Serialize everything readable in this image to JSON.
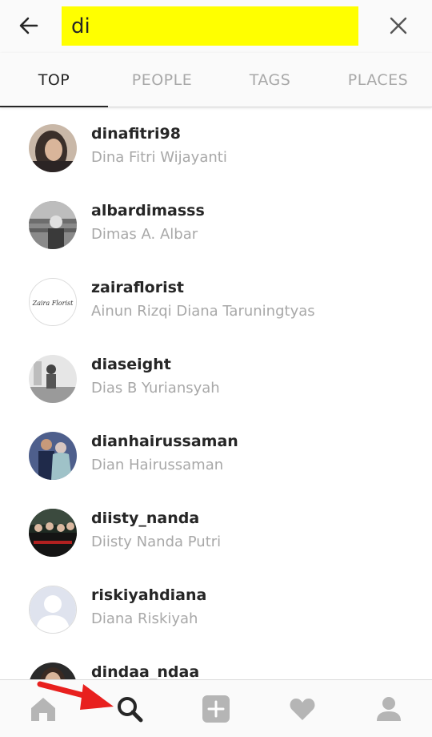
{
  "search": {
    "query": "di"
  },
  "tabs": [
    {
      "label": "TOP",
      "active": true
    },
    {
      "label": "PEOPLE",
      "active": false
    },
    {
      "label": "TAGS",
      "active": false
    },
    {
      "label": "PLACES",
      "active": false
    }
  ],
  "results": [
    {
      "username": "dinafitri98",
      "full_name": "Dina Fitri Wijayanti"
    },
    {
      "username": "albardimasss",
      "full_name": "Dimas A. Albar"
    },
    {
      "username": "zairaflorist",
      "full_name": "Ainun Rizqi Diana Taruningtyas",
      "avatar_text": "Zaira Florist"
    },
    {
      "username": "diaseight",
      "full_name": "Dias B Yuriansyah"
    },
    {
      "username": "dianhairussaman",
      "full_name": "Dian Hairussaman"
    },
    {
      "username": "diisty_nanda",
      "full_name": "Diisty Nanda Putri"
    },
    {
      "username": "riskiyahdiana",
      "full_name": "Diana Riskiyah"
    },
    {
      "username": "dindaa_ndaa",
      "full_name": ""
    }
  ],
  "bottom_nav": [
    {
      "icon": "home-icon"
    },
    {
      "icon": "search-icon",
      "active": true
    },
    {
      "icon": "add-icon"
    },
    {
      "icon": "heart-icon"
    },
    {
      "icon": "profile-icon"
    }
  ],
  "colors": {
    "highlight": "#ffff00",
    "annotation_arrow": "#e8201e"
  }
}
